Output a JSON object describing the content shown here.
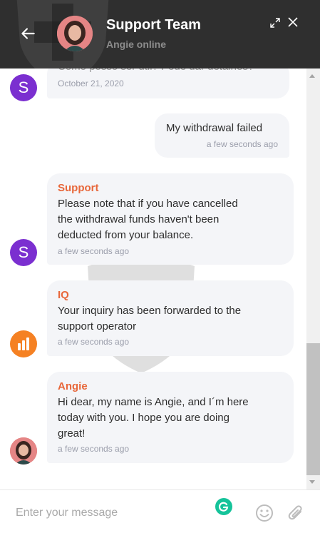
{
  "header": {
    "title": "Support Team",
    "subtitle": "Angie online",
    "back_icon": "arrow-left-icon",
    "expand_icon": "expand-icon",
    "close_icon": "close-icon"
  },
  "messages": [
    {
      "type": "in",
      "sender": "",
      "text": "Como posso ser útil? Pode dar detalhes?",
      "time": "October 21, 2020",
      "avatar": "S"
    },
    {
      "type": "out",
      "text": "My withdrawal failed",
      "time": "a few seconds ago"
    },
    {
      "type": "in",
      "sender": "Support",
      "text_lines": [
        "Please note that if you have cancelled",
        "the withdrawal funds haven't been",
        "deducted from your balance."
      ],
      "time": "a few seconds ago",
      "avatar": "S"
    },
    {
      "type": "in",
      "sender": "IQ",
      "text_lines": [
        "Your inquiry has been forwarded to the",
        "support operator"
      ],
      "time": "a few seconds ago",
      "avatar": "iq-logo"
    },
    {
      "type": "in",
      "sender": "Angie",
      "text_lines": [
        "Hi dear, my name is Angie, and I´m here",
        "today with you. I hope you are doing",
        "great!"
      ],
      "time": "a few seconds ago",
      "avatar": "angie-photo"
    }
  ],
  "input": {
    "placeholder": "Enter your message",
    "emoji_icon": "emoji-icon",
    "attach_icon": "paperclip-icon"
  },
  "colors": {
    "header_bg": "#2f2f2f",
    "sender": "#e8673a",
    "bubble": "#f4f5f8",
    "avatar_s": "#7b2fd0",
    "avatar_iq": "#f58123"
  }
}
